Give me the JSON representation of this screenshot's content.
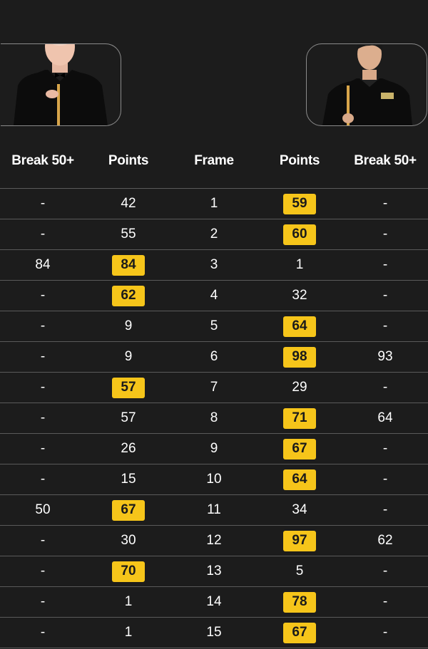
{
  "header": {
    "left_break": "Break 50+",
    "left_points": "Points",
    "frame": "Frame",
    "right_points": "Points",
    "right_break": "Break 50+"
  },
  "colors": {
    "background": "#1c1c1c",
    "highlight": "#f6c51a",
    "divider": "#5a5a5a"
  },
  "frames": [
    {
      "lb": "-",
      "lp": "42",
      "f": "1",
      "rp": "59",
      "rb": "-",
      "winner": "right"
    },
    {
      "lb": "-",
      "lp": "55",
      "f": "2",
      "rp": "60",
      "rb": "-",
      "winner": "right"
    },
    {
      "lb": "84",
      "lp": "84",
      "f": "3",
      "rp": "1",
      "rb": "-",
      "winner": "left"
    },
    {
      "lb": "-",
      "lp": "62",
      "f": "4",
      "rp": "32",
      "rb": "-",
      "winner": "left"
    },
    {
      "lb": "-",
      "lp": "9",
      "f": "5",
      "rp": "64",
      "rb": "-",
      "winner": "right"
    },
    {
      "lb": "-",
      "lp": "9",
      "f": "6",
      "rp": "98",
      "rb": "93",
      "winner": "right"
    },
    {
      "lb": "-",
      "lp": "57",
      "f": "7",
      "rp": "29",
      "rb": "-",
      "winner": "left"
    },
    {
      "lb": "-",
      "lp": "57",
      "f": "8",
      "rp": "71",
      "rb": "64",
      "winner": "right"
    },
    {
      "lb": "-",
      "lp": "26",
      "f": "9",
      "rp": "67",
      "rb": "-",
      "winner": "right"
    },
    {
      "lb": "-",
      "lp": "15",
      "f": "10",
      "rp": "64",
      "rb": "-",
      "winner": "right"
    },
    {
      "lb": "50",
      "lp": "67",
      "f": "11",
      "rp": "34",
      "rb": "-",
      "winner": "left"
    },
    {
      "lb": "-",
      "lp": "30",
      "f": "12",
      "rp": "97",
      "rb": "62",
      "winner": "right"
    },
    {
      "lb": "-",
      "lp": "70",
      "f": "13",
      "rp": "5",
      "rb": "-",
      "winner": "left"
    },
    {
      "lb": "-",
      "lp": "1",
      "f": "14",
      "rp": "78",
      "rb": "-",
      "winner": "right"
    },
    {
      "lb": "-",
      "lp": "1",
      "f": "15",
      "rp": "67",
      "rb": "-",
      "winner": "right"
    }
  ]
}
